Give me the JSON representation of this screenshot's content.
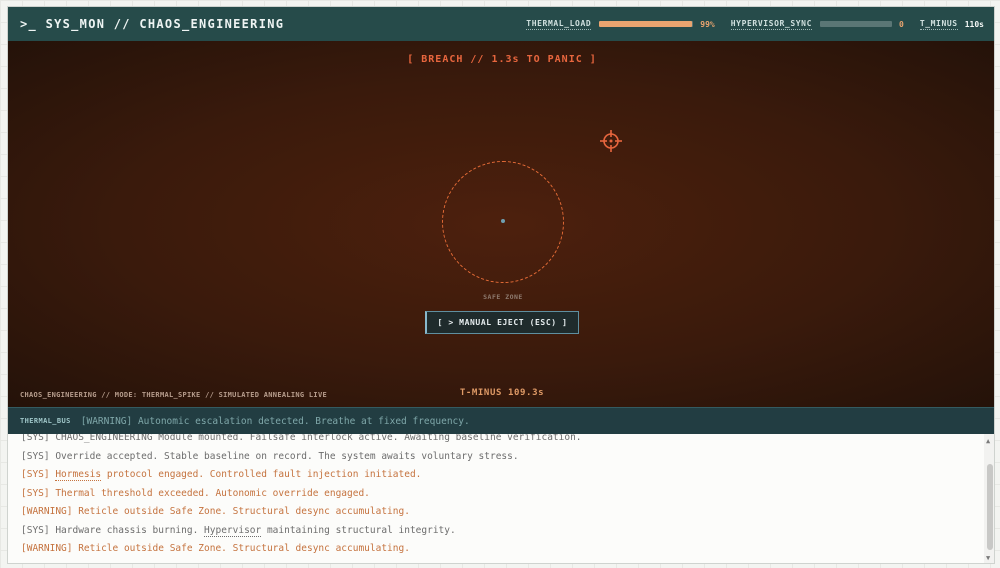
{
  "header": {
    "title": ">_ SYS_MON // CHAOS_ENGINEERING",
    "thermal_load": {
      "label": "THERMAL_LOAD",
      "value": "99%",
      "fraction": 0.99
    },
    "hypervisor_sync": {
      "label": "HYPERVISOR_SYNC",
      "value": "0",
      "fraction": 0.0
    },
    "t_minus": {
      "label": "T_MINUS",
      "value": "110s"
    }
  },
  "arena": {
    "breach_text": "[ BREACH // 1.3s TO PANIC ]",
    "safe_zone_label": "SAFE ZONE",
    "eject_button": "[ > MANUAL EJECT (ESC) ]",
    "status_line": "CHAOS_ENGINEERING // MODE: THERMAL_SPIKE // SIMULATED ANNEALING LIVE",
    "t_minus_text": "T-MINUS 109.3s"
  },
  "bus": {
    "tag": "THERMAL_BUS",
    "message": "[WARNING] Autonomic escalation detected. Breathe at fixed frequency."
  },
  "log": {
    "lines": [
      {
        "type": "sys",
        "text": "[SYS] CHAOS_ENGINEERING Module mounted. Failsafe interlock active. Awaiting baseline verification."
      },
      {
        "type": "sys",
        "text": "[SYS] Override accepted. Stable baseline on record. The system awaits voluntary stress."
      },
      {
        "type": "warn",
        "prefix": "[SYS] ",
        "highlight": "Hormesis",
        "suffix": " protocol engaged. Controlled fault injection initiated."
      },
      {
        "type": "warn",
        "text": "[SYS] Thermal threshold exceeded. Autonomic override engaged."
      },
      {
        "type": "warn",
        "text": "[WARNING] Reticle outside Safe Zone. Structural desync accumulating."
      },
      {
        "type": "sys",
        "prefix": "[SYS] Hardware chassis burning. ",
        "highlight": "Hypervisor",
        "suffix": " maintaining structural integrity."
      },
      {
        "type": "warn",
        "text": "[WARNING] Reticle outside Safe Zone. Structural desync accumulating."
      }
    ]
  },
  "colors": {
    "header_bg": "#264b4a",
    "thermal_fill": "#e9a46f",
    "breach": "#e8663e",
    "warning_text": "#c5733f"
  },
  "icons": {
    "reticle": "crosshair-icon",
    "scroll_up": "arrow-up-icon",
    "scroll_down": "arrow-down-icon"
  }
}
